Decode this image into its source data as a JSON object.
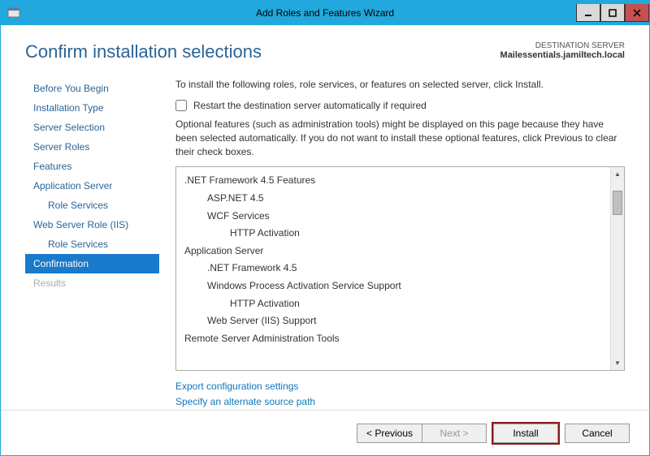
{
  "window": {
    "title": "Add Roles and Features Wizard"
  },
  "header": {
    "pageTitle": "Confirm installation selections",
    "destinationLabel": "DESTINATION SERVER",
    "destinationName": "Mailessentials.jamiltech.local"
  },
  "nav": {
    "items": [
      {
        "label": "Before You Begin",
        "sub": false,
        "active": false,
        "disabled": false
      },
      {
        "label": "Installation Type",
        "sub": false,
        "active": false,
        "disabled": false
      },
      {
        "label": "Server Selection",
        "sub": false,
        "active": false,
        "disabled": false
      },
      {
        "label": "Server Roles",
        "sub": false,
        "active": false,
        "disabled": false
      },
      {
        "label": "Features",
        "sub": false,
        "active": false,
        "disabled": false
      },
      {
        "label": "Application Server",
        "sub": false,
        "active": false,
        "disabled": false
      },
      {
        "label": "Role Services",
        "sub": true,
        "active": false,
        "disabled": false
      },
      {
        "label": "Web Server Role (IIS)",
        "sub": false,
        "active": false,
        "disabled": false
      },
      {
        "label": "Role Services",
        "sub": true,
        "active": false,
        "disabled": false
      },
      {
        "label": "Confirmation",
        "sub": false,
        "active": true,
        "disabled": false
      },
      {
        "label": "Results",
        "sub": false,
        "active": false,
        "disabled": true
      }
    ]
  },
  "main": {
    "instruction": "To install the following roles, role services, or features on selected server, click Install.",
    "restartLabel": "Restart the destination server automatically if required",
    "optionalText": "Optional features (such as administration tools) might be displayed on this page because they have been selected automatically. If you do not want to install these optional features, click Previous to clear their check boxes.",
    "features": [
      {
        "label": ".NET Framework 4.5 Features",
        "level": 0
      },
      {
        "label": "ASP.NET 4.5",
        "level": 1
      },
      {
        "label": "WCF Services",
        "level": 1
      },
      {
        "label": "HTTP Activation",
        "level": 2
      },
      {
        "label": "Application Server",
        "level": 0
      },
      {
        "label": ".NET Framework 4.5",
        "level": 1
      },
      {
        "label": "Windows Process Activation Service Support",
        "level": 1
      },
      {
        "label": "HTTP Activation",
        "level": 2
      },
      {
        "label": "Web Server (IIS) Support",
        "level": 1
      },
      {
        "label": "Remote Server Administration Tools",
        "level": 0
      }
    ],
    "links": {
      "export": "Export configuration settings",
      "altSource": "Specify an alternate source path"
    }
  },
  "footer": {
    "previous": "< Previous",
    "next": "Next >",
    "install": "Install",
    "cancel": "Cancel"
  }
}
